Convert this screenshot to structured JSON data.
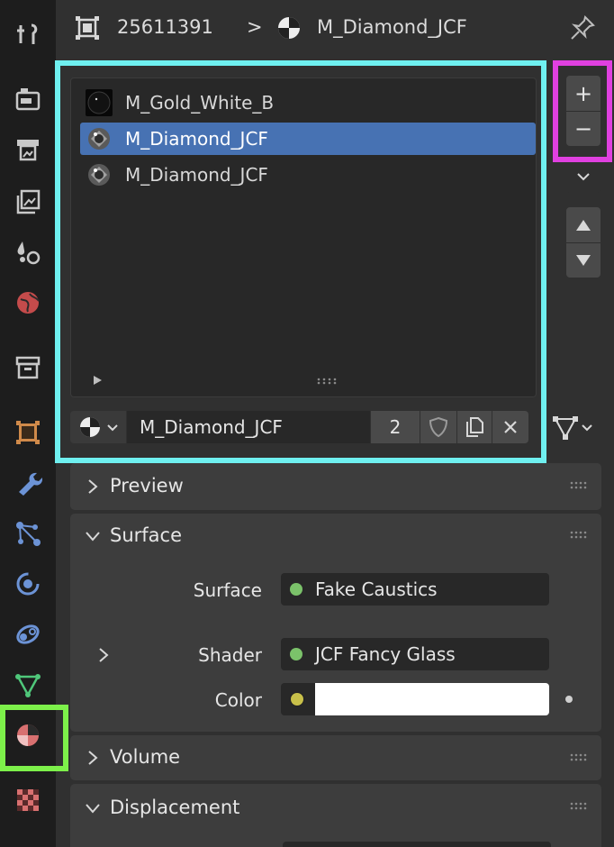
{
  "header": {
    "object_id": "25611391",
    "separator": ">",
    "material_name": "M_Diamond_JCF"
  },
  "sidebar_tabs": [
    {
      "name": "tool-tab",
      "icon": "wrench-screwdriver-icon"
    },
    {
      "name": "render-tab",
      "icon": "camera-back-icon"
    },
    {
      "name": "output-tab",
      "icon": "printer-icon"
    },
    {
      "name": "view-layer-tab",
      "icon": "images-icon"
    },
    {
      "name": "scene-tab",
      "icon": "scene-drops-icon"
    },
    {
      "name": "world-tab",
      "icon": "globe-icon"
    },
    {
      "name": "collection-tab",
      "icon": "box-icon"
    },
    {
      "name": "object-tab",
      "icon": "object-square-icon"
    },
    {
      "name": "modifiers-tab",
      "icon": "wrench-icon"
    },
    {
      "name": "particles-tab",
      "icon": "particles-icon"
    },
    {
      "name": "physics-tab",
      "icon": "physics-orbit-icon"
    },
    {
      "name": "constraints-tab",
      "icon": "constraint-icon"
    },
    {
      "name": "data-tab",
      "icon": "mesh-triangle-icon"
    },
    {
      "name": "material-tab",
      "icon": "material-sphere-icon"
    },
    {
      "name": "texture-tab",
      "icon": "checker-icon"
    }
  ],
  "material_slots": [
    {
      "label": "M_Gold_White_B",
      "selected": false
    },
    {
      "label": "M_Diamond_JCF",
      "selected": true
    },
    {
      "label": "M_Diamond_JCF",
      "selected": false
    }
  ],
  "slot_buttons": {
    "add": "+",
    "remove": "−"
  },
  "datablock": {
    "name": "M_Diamond_JCF",
    "users": "2"
  },
  "sections": {
    "preview": "Preview",
    "surface": "Surface",
    "volume": "Volume",
    "displacement": "Displacement"
  },
  "surface_props": {
    "surface_label": "Surface",
    "surface_value": "Fake Caustics",
    "shader_label": "Shader",
    "shader_value": "JCF Fancy Glass",
    "color_label": "Color",
    "color_value": "#ffffff"
  },
  "highlight_colors": {
    "list": "#6ff0f0",
    "add_remove": "#e040e0",
    "material_tab": "#7df04a"
  }
}
